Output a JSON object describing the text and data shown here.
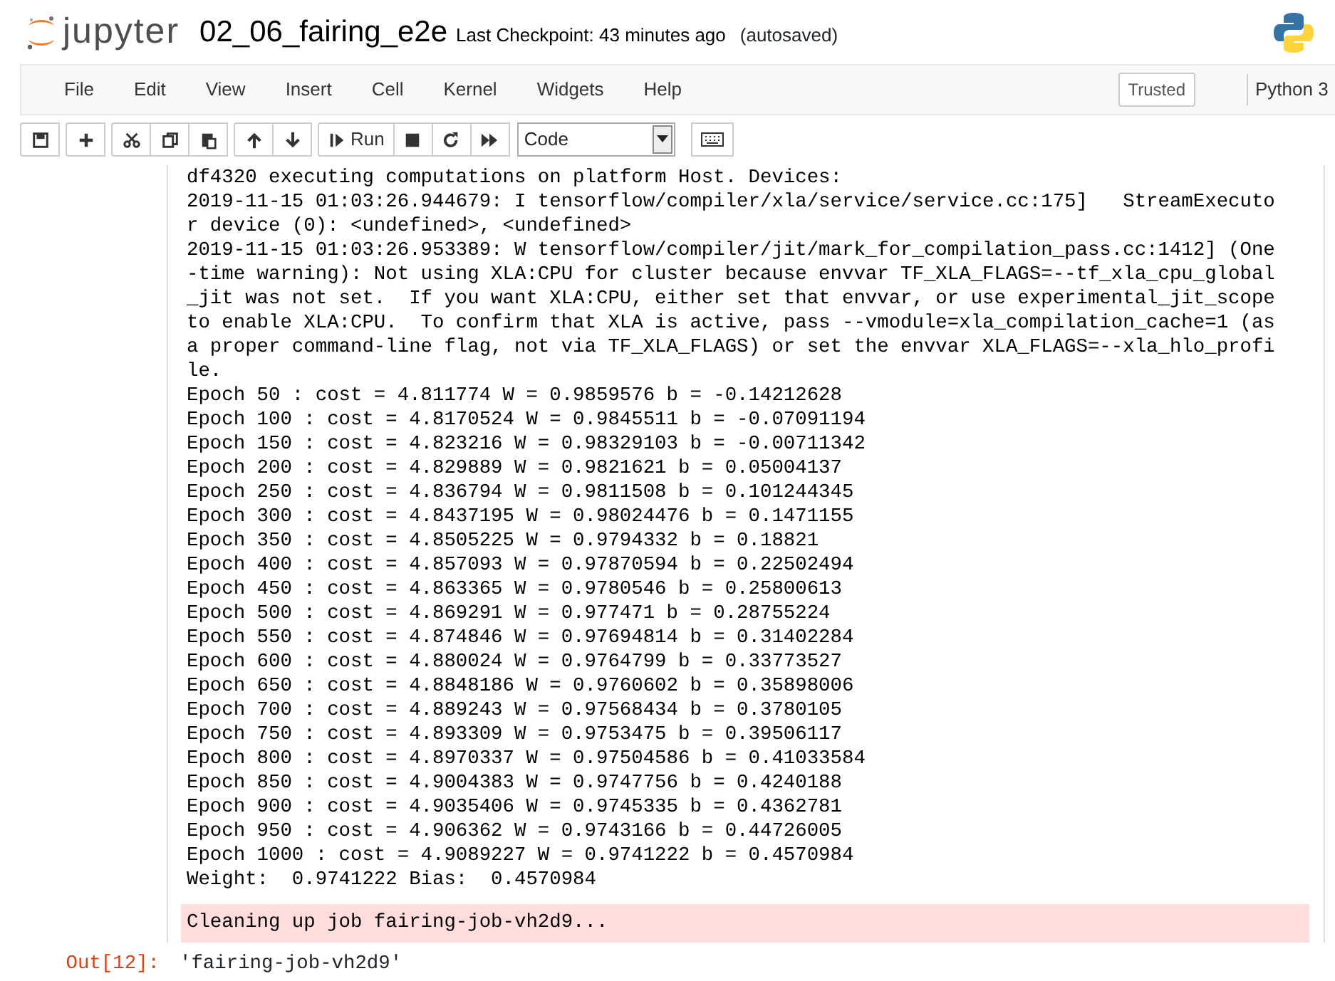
{
  "header": {
    "logo_text": "jupyter",
    "notebook_name": "02_06_fairing_e2e",
    "checkpoint": "Last Checkpoint: 43 minutes ago",
    "autosave": "(autosaved)"
  },
  "menu": [
    "File",
    "Edit",
    "View",
    "Insert",
    "Cell",
    "Kernel",
    "Widgets",
    "Help"
  ],
  "trusted": "Trusted",
  "kernel": "Python 3",
  "toolbar": [
    [
      {
        "kind": "save"
      }
    ],
    [
      {
        "kind": "add"
      }
    ],
    [
      {
        "kind": "cut"
      },
      {
        "kind": "copy"
      },
      {
        "kind": "paste"
      }
    ],
    [
      {
        "kind": "up"
      },
      {
        "kind": "down"
      }
    ],
    [
      {
        "kind": "run",
        "label": "Run"
      },
      {
        "kind": "stop"
      },
      {
        "kind": "restart"
      },
      {
        "kind": "fastforward"
      }
    ]
  ],
  "cell_type": "Code",
  "output_lines": [
    "df4320 executing computations on platform Host. Devices:",
    "2019-11-15 01:03:26.944679: I tensorflow/compiler/xla/service/service.cc:175]   StreamExecuto",
    "r device (0): <undefined>, <undefined>",
    "2019-11-15 01:03:26.953389: W tensorflow/compiler/jit/mark_for_compilation_pass.cc:1412] (One",
    "-time warning): Not using XLA:CPU for cluster because envvar TF_XLA_FLAGS=--tf_xla_cpu_global",
    "_jit was not set.  If you want XLA:CPU, either set that envvar, or use experimental_jit_scope",
    "to enable XLA:CPU.  To confirm that XLA is active, pass --vmodule=xla_compilation_cache=1 (as",
    "a proper command-line flag, not via TF_XLA_FLAGS) or set the envvar XLA_FLAGS=--xla_hlo_profi",
    "le.",
    "Epoch 50 : cost = 4.811774 W = 0.9859576 b = -0.14212628",
    "Epoch 100 : cost = 4.8170524 W = 0.9845511 b = -0.07091194",
    "Epoch 150 : cost = 4.823216 W = 0.98329103 b = -0.00711342",
    "Epoch 200 : cost = 4.829889 W = 0.9821621 b = 0.05004137",
    "Epoch 250 : cost = 4.836794 W = 0.9811508 b = 0.101244345",
    "Epoch 300 : cost = 4.8437195 W = 0.98024476 b = 0.1471155",
    "Epoch 350 : cost = 4.8505225 W = 0.9794332 b = 0.18821",
    "Epoch 400 : cost = 4.857093 W = 0.97870594 b = 0.22502494",
    "Epoch 450 : cost = 4.863365 W = 0.9780546 b = 0.25800613",
    "Epoch 500 : cost = 4.869291 W = 0.977471 b = 0.28755224",
    "Epoch 550 : cost = 4.874846 W = 0.97694814 b = 0.31402284",
    "Epoch 600 : cost = 4.880024 W = 0.9764799 b = 0.33773527",
    "Epoch 650 : cost = 4.8848186 W = 0.9760602 b = 0.35898006",
    "Epoch 700 : cost = 4.889243 W = 0.97568434 b = 0.3780105",
    "Epoch 750 : cost = 4.893309 W = 0.9753475 b = 0.39506117",
    "Epoch 800 : cost = 4.8970337 W = 0.97504586 b = 0.41033584",
    "Epoch 850 : cost = 4.9004383 W = 0.9747756 b = 0.4240188",
    "Epoch 900 : cost = 4.9035406 W = 0.9745335 b = 0.4362781",
    "Epoch 950 : cost = 4.906362 W = 0.9743166 b = 0.44726005",
    "Epoch 1000 : cost = 4.9089227 W = 0.9741222 b = 0.4570984",
    "Weight:  0.9741222 Bias:  0.4570984"
  ],
  "stderr": "Cleaning up job fairing-job-vh2d9...",
  "out_prompt": "Out[12]:",
  "out_value": "'fairing-job-vh2d9'"
}
